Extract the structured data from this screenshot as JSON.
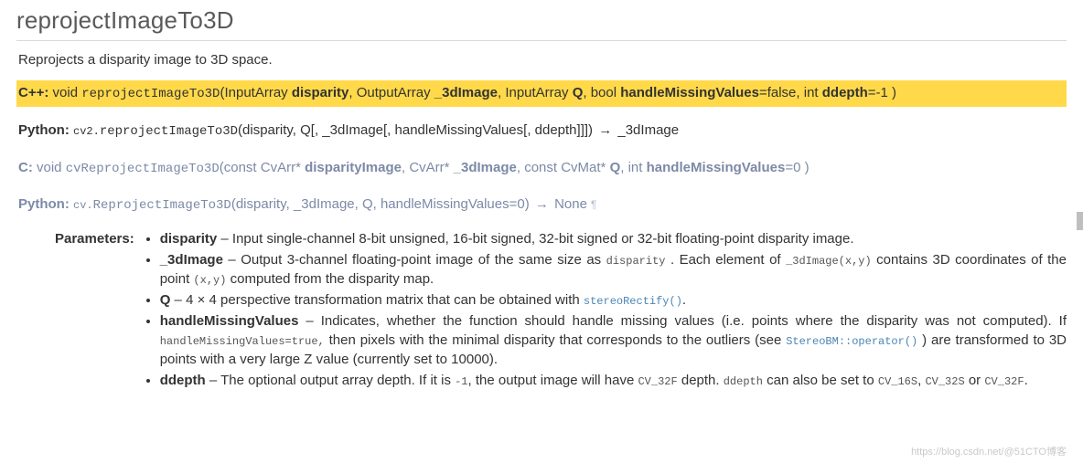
{
  "title": "reprojectImageTo3D",
  "description": "Reprojects a disparity image to 3D space.",
  "sig_cpp": {
    "lang": "C++:",
    "ret": "void",
    "name": "reprojectImageTo3D",
    "open": "(",
    "a1_t": "InputArray ",
    "a1_n": "disparity",
    "sep1": ", ",
    "a2_t": "OutputArray ",
    "a2_n": "_3dImage",
    "sep2": ", ",
    "a3_t": "InputArray ",
    "a3_n": "Q",
    "sep3": ", ",
    "a4_t": "bool ",
    "a4_n": "handleMissingValues",
    "a4_d": "=false",
    "sep4": ", ",
    "a5_t": "int ",
    "a5_n": "ddepth",
    "a5_d": "=-1",
    "close": " )"
  },
  "sig_py": {
    "lang": "Python:",
    "module": "cv2.",
    "name": "reprojectImageTo3D",
    "args": "(disparity, Q[, _3dImage[, handleMissingValues[, ddepth]]])",
    "arrow": "→",
    "ret": "_3dImage"
  },
  "sig_c": {
    "lang": "C:",
    "ret": "void",
    "name": "cvReprojectImageTo3D",
    "open": "(",
    "a1_t": "const CvArr* ",
    "a1_n": "disparityImage",
    "sep1": ", ",
    "a2_t": "CvArr* ",
    "a2_n": "_3dImage",
    "sep2": ", ",
    "a3_t": "const CvMat* ",
    "a3_n": "Q",
    "sep3": ", ",
    "a4_t": "int ",
    "a4_n": "handleMissingValues",
    "a4_d": "=0",
    "close": " )"
  },
  "sig_py2": {
    "lang": "Python:",
    "module": "cv.",
    "name": "ReprojectImageTo3D",
    "args": "(disparity, _3dImage, Q, handleMissingValues=0)",
    "arrow": "→",
    "ret": "None"
  },
  "params_label": "Parameters:",
  "params": {
    "p1_n": "disparity",
    "p1_t": " – Input single-channel 8-bit unsigned, 16-bit signed, 32-bit signed or 32-bit floating-point disparity image.",
    "p2_n": "_3dImage",
    "p2_a": " – Output 3-channel floating-point image of the same size as ",
    "p2_c1": "disparity",
    "p2_b": " . Each element of ",
    "p2_c2": "_3dImage(x,y)",
    "p2_c": " contains 3D coordinates of the point ",
    "p2_c3": "(x,y)",
    "p2_d": " computed from the disparity map.",
    "p3_n": "Q",
    "p3_a": " – 4 × 4 perspective transformation matrix that can be obtained with ",
    "p3_l": "stereoRectify()",
    "p3_b": ".",
    "p4_n": "handleMissingValues",
    "p4_a": " – Indicates, whether the function should handle missing values (i.e. points where the disparity was not computed). If ",
    "p4_c1": "handleMissingValues=true,",
    "p4_b": " then pixels with the minimal disparity that corresponds to the outliers (see ",
    "p4_l": "StereoBM::operator()",
    "p4_c": " ) are transformed to 3D points with a very large Z value (currently set to 10000).",
    "p5_n": "ddepth",
    "p5_a": " – The optional output array depth. If it is ",
    "p5_c1": "-1",
    "p5_b": ", the output image will have ",
    "p5_c2": "CV_32F",
    "p5_c": " depth. ",
    "p5_c3": "ddepth",
    "p5_d": " can also be set to ",
    "p5_c4": "CV_16S",
    "p5_e": ", ",
    "p5_c5": "CV_32S",
    "p5_f": " or ",
    "p5_c6": "CV_32F",
    "p5_g": "."
  },
  "watermark": "https://blog.csdn.net/@51CTO博客"
}
